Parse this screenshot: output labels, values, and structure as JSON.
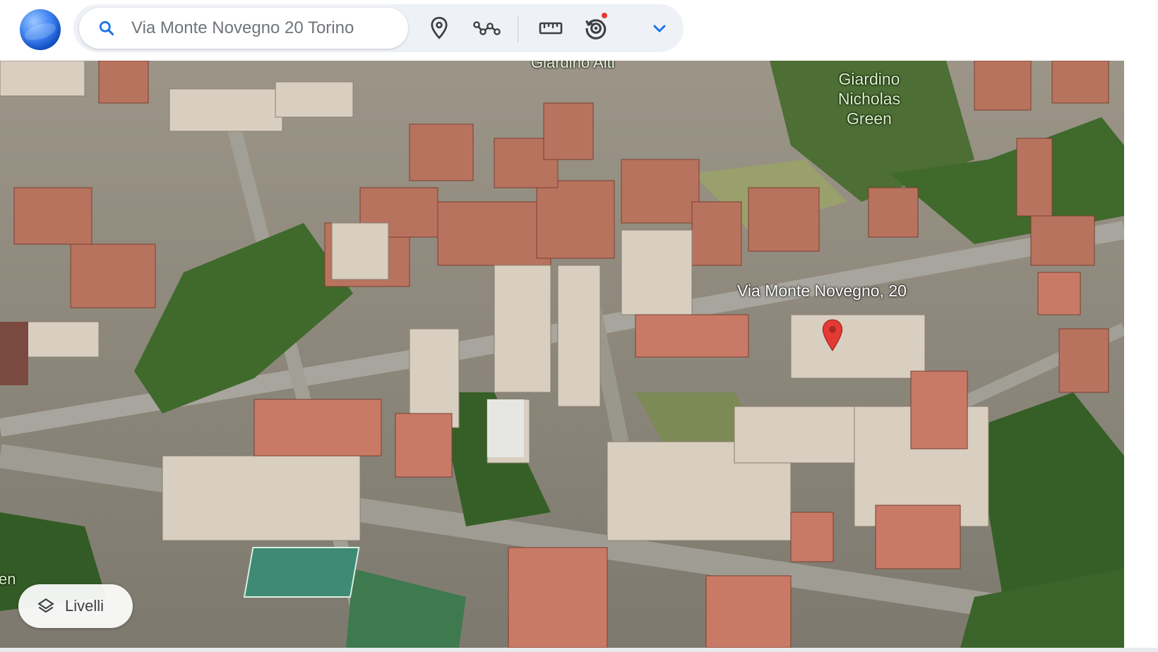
{
  "app": {
    "logo_icon": "google-earth-globe-icon"
  },
  "search": {
    "placeholder": "Via Monte Novegno 20 Torino",
    "value": "",
    "icon": "search-icon"
  },
  "toolbar": {
    "tools": [
      {
        "id": "place",
        "icon": "place-marker-icon"
      },
      {
        "id": "path",
        "icon": "path-icon"
      },
      {
        "id": "measure",
        "icon": "ruler-icon"
      },
      {
        "id": "history",
        "icon": "historical-imagery-icon",
        "has_badge": true
      },
      {
        "id": "more",
        "icon": "chevron-down-icon"
      }
    ],
    "accent_color": "#1a73e8",
    "badge_color": "#e53935"
  },
  "map": {
    "labels": {
      "park_lines": [
        "Giardino",
        "Nicholas",
        "Green"
      ],
      "address": "Via Monte Novegno, 20",
      "partial_top": "Giardino Alti",
      "partial_left": "en"
    },
    "pin_color": "#e53935"
  },
  "layers": {
    "label": "Livelli",
    "icon": "layers-icon"
  }
}
